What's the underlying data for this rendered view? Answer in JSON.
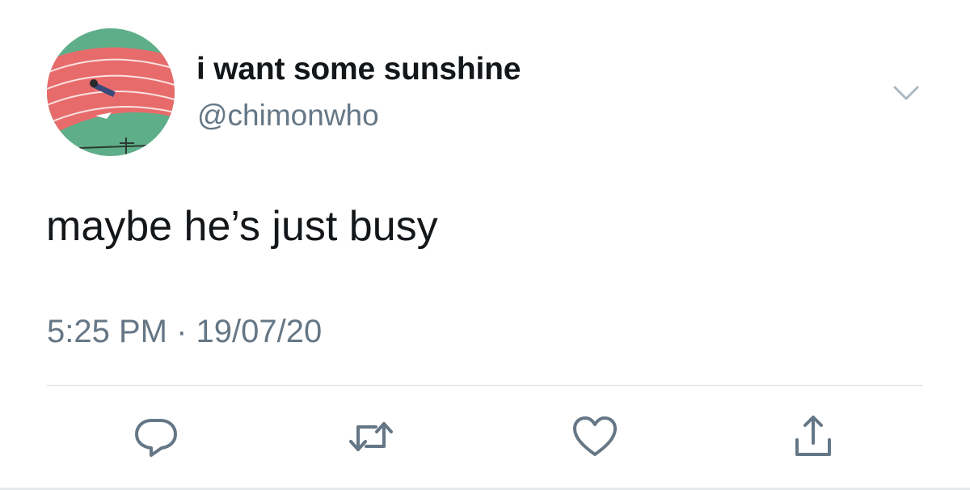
{
  "tweet": {
    "display_name": "i want some sunshine",
    "handle": "@chimonwho",
    "text": "maybe he’s just busy",
    "timestamp": "5:25 PM · 19/07/20"
  },
  "icons": {
    "avatar": "avatar-photo-running-track",
    "more": "chevron-down-icon",
    "reply": "reply-icon",
    "retweet": "retweet-icon",
    "like": "heart-icon",
    "share": "share-icon"
  },
  "colors": {
    "text_primary": "#14171a",
    "text_secondary": "#657786",
    "icon": "#657786",
    "divider": "#d9dee3"
  }
}
